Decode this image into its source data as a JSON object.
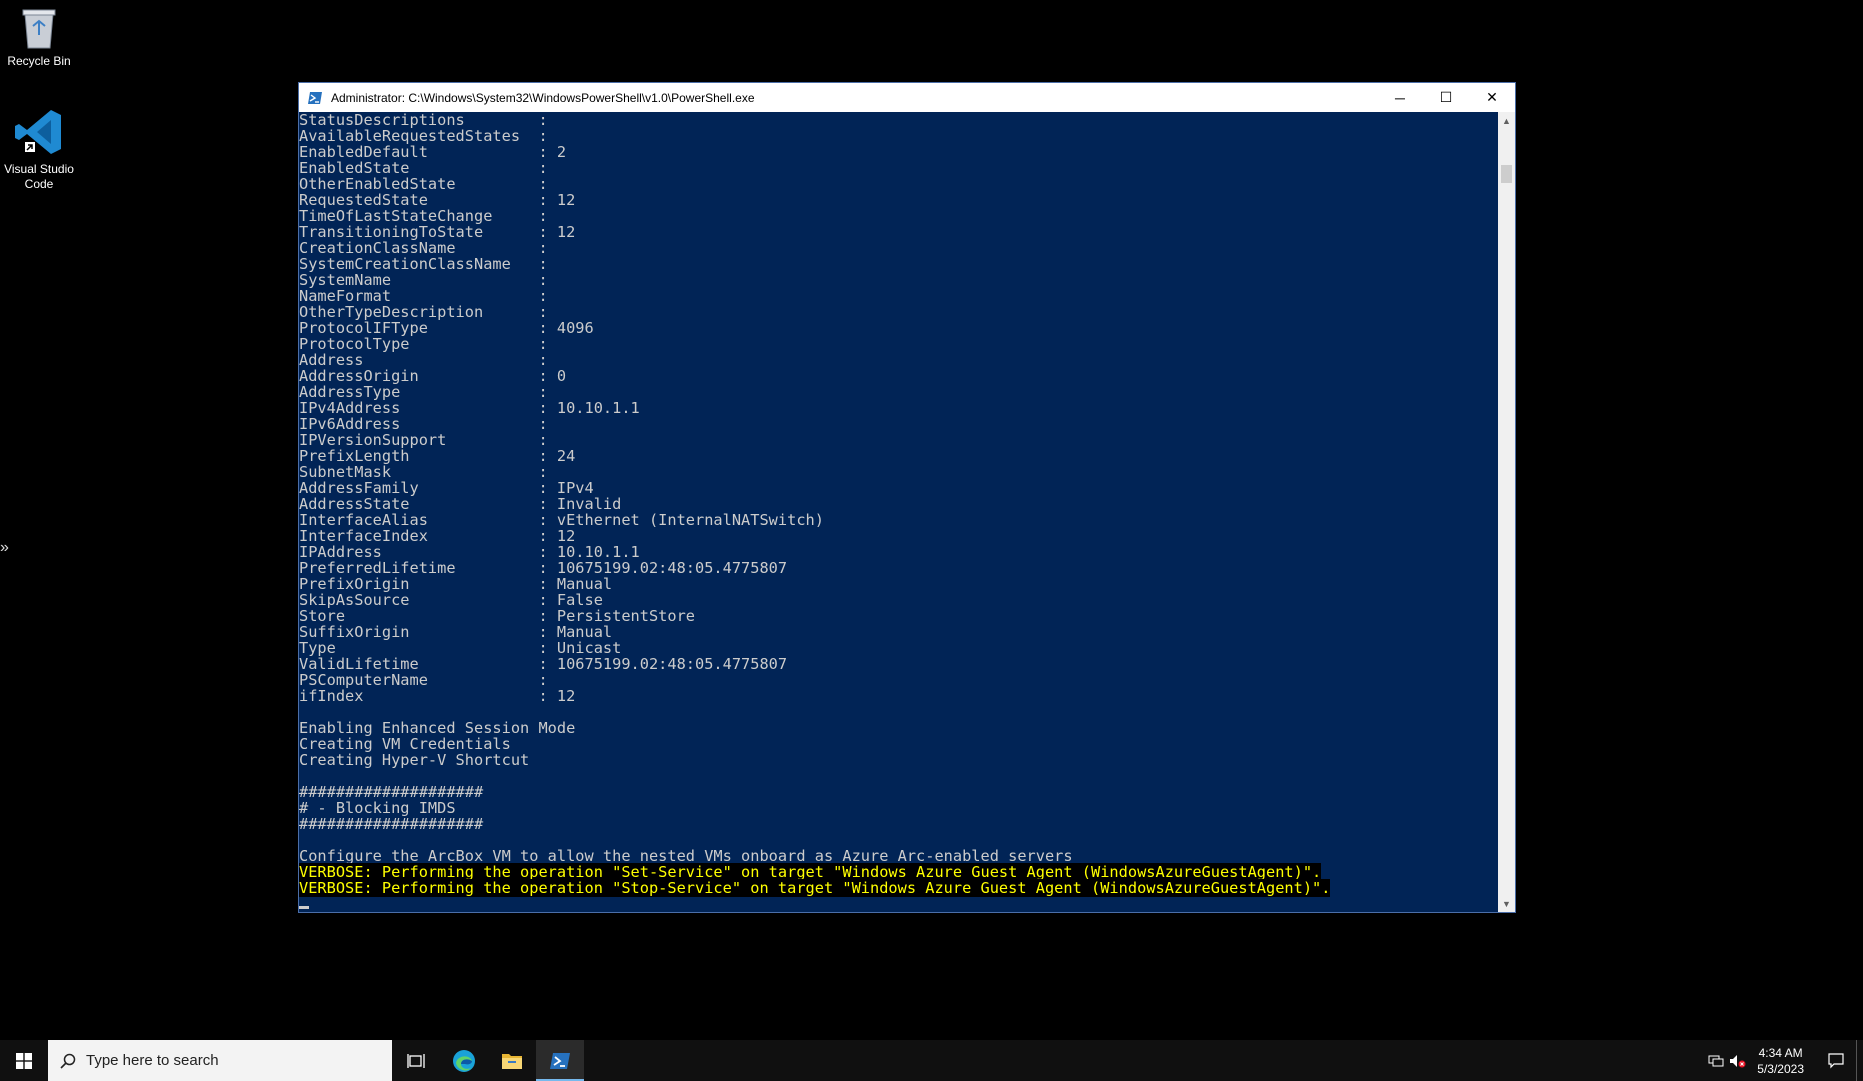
{
  "desktop": {
    "icons": [
      {
        "label": "Recycle Bin",
        "icon": "recycle-bin-icon"
      },
      {
        "label": "Visual Studio Code",
        "icon": "vscode-icon"
      }
    ]
  },
  "window": {
    "title": "Administrator: C:\\Windows\\System32\\WindowsPowerShell\\v1.0\\PowerShell.exe",
    "minimize_label": "─",
    "maximize_label": "☐",
    "close_label": "✕"
  },
  "console": {
    "output": "StatusDescriptions        : \nAvailableRequestedStates  : \nEnabledDefault            : 2\nEnabledState              : \nOtherEnabledState         : \nRequestedState            : 12\nTimeOfLastStateChange     : \nTransitioningToState      : 12\nCreationClassName         : \nSystemCreationClassName   : \nSystemName                : \nNameFormat                : \nOtherTypeDescription      : \nProtocolIFType            : 4096\nProtocolType              : \nAddress                   : \nAddressOrigin             : 0\nAddressType               : \nIPv4Address               : 10.10.1.1\nIPv6Address               : \nIPVersionSupport          : \nPrefixLength              : 24\nSubnetMask                : \nAddressFamily             : IPv4\nAddressState              : Invalid\nInterfaceAlias            : vEthernet (InternalNATSwitch)\nInterfaceIndex            : 12\nIPAddress                 : 10.10.1.1\nPreferredLifetime         : 10675199.02:48:05.4775807\nPrefixOrigin              : Manual\nSkipAsSource              : False\nStore                     : PersistentStore\nSuffixOrigin              : Manual\nType                      : Unicast\nValidLifetime             : 10675199.02:48:05.4775807\nPSComputerName            : \nifIndex                   : 12\n\nEnabling Enhanced Session Mode\nCreating VM Credentials\nCreating Hyper-V Shortcut\n\n####################\n# - Blocking IMDS\n####################\n\nConfigure the ArcBox VM to allow the nested VMs onboard as Azure Arc-enabled servers",
    "verbose_lines": [
      "VERBOSE: Performing the operation \"Set-Service\" on target \"Windows Azure Guest Agent (WindowsAzureGuestAgent)\".",
      "VERBOSE: Performing the operation \"Stop-Service\" on target \"Windows Azure Guest Agent (WindowsAzureGuestAgent)\"."
    ]
  },
  "taskbar": {
    "search_placeholder": "Type here to search",
    "apps": [
      "task-view-icon",
      "edge-icon",
      "file-explorer-icon",
      "powershell-icon"
    ],
    "clock_time": "4:34 AM",
    "clock_date": "5/3/2023"
  },
  "colors": {
    "console_bg": "#012456",
    "console_fg": "#cccccc",
    "verbose_fg": "#ffff00",
    "taskbar_bg": "#101010"
  }
}
